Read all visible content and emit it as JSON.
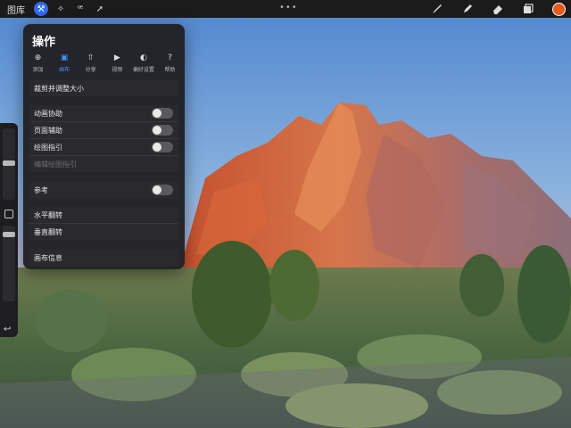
{
  "topbar": {
    "gallery_label": "图库",
    "tools": [
      {
        "icon": "wrench-icon",
        "glyph": "⚒",
        "active": true
      },
      {
        "icon": "magic-wand-icon",
        "glyph": "✧",
        "active": false
      },
      {
        "icon": "selection-icon",
        "glyph": "ꟹ",
        "active": false
      },
      {
        "icon": "transform-arrow-icon",
        "glyph": "➚",
        "active": false
      }
    ],
    "more_label": "•••",
    "right_tools": [
      {
        "icon": "brush-icon"
      },
      {
        "icon": "smudge-icon"
      },
      {
        "icon": "eraser-icon"
      },
      {
        "icon": "layers-icon"
      }
    ],
    "color": "#e8591c"
  },
  "actions_panel": {
    "title": "操作",
    "tabs": [
      {
        "label": "添加",
        "glyph": "⊕",
        "active": false
      },
      {
        "label": "画布",
        "glyph": "▣",
        "active": true
      },
      {
        "label": "分享",
        "glyph": "⇧",
        "active": false
      },
      {
        "label": "视频",
        "glyph": "▶",
        "active": false
      },
      {
        "label": "偏好设置",
        "glyph": "◐",
        "active": false
      },
      {
        "label": "帮助",
        "glyph": "?",
        "active": false
      }
    ],
    "crop_resize": "裁剪并调整大小",
    "animation_assist": "动画协助",
    "page_assist": "页面辅助",
    "drawing_guide": "绘图指引",
    "edit_drawing_guide": "编辑绘图指引",
    "reference": "参考",
    "flip_horizontal": "水平翻转",
    "flip_vertical": "垂直翻转",
    "canvas_info": "画布信息"
  },
  "accent_color": "#2f6bf0"
}
